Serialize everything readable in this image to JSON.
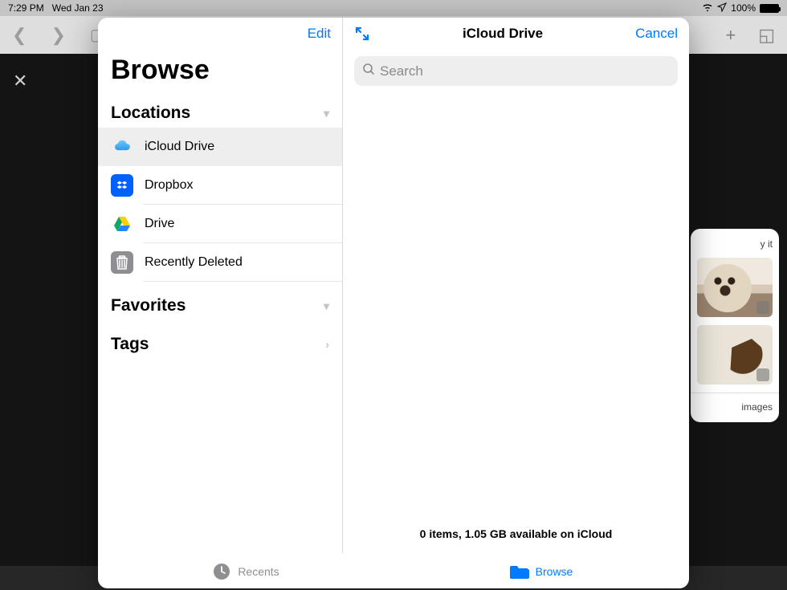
{
  "status": {
    "time": "7:29 PM",
    "date": "Wed Jan 23",
    "battery": "100%"
  },
  "sidebar": {
    "edit": "Edit",
    "title": "Browse",
    "sections": {
      "locations": "Locations",
      "favorites": "Favorites",
      "tags": "Tags"
    },
    "items": [
      {
        "label": "iCloud Drive"
      },
      {
        "label": "Dropbox"
      },
      {
        "label": "Drive"
      },
      {
        "label": "Recently Deleted"
      }
    ]
  },
  "main": {
    "title": "iCloud Drive",
    "cancel": "Cancel",
    "search_placeholder": "Search",
    "status": "0 items, 1.05 GB available on iCloud"
  },
  "tabs": {
    "recents": "Recents",
    "browse": "Browse"
  },
  "backdrop": {
    "hint": "y it",
    "footer": "images"
  }
}
